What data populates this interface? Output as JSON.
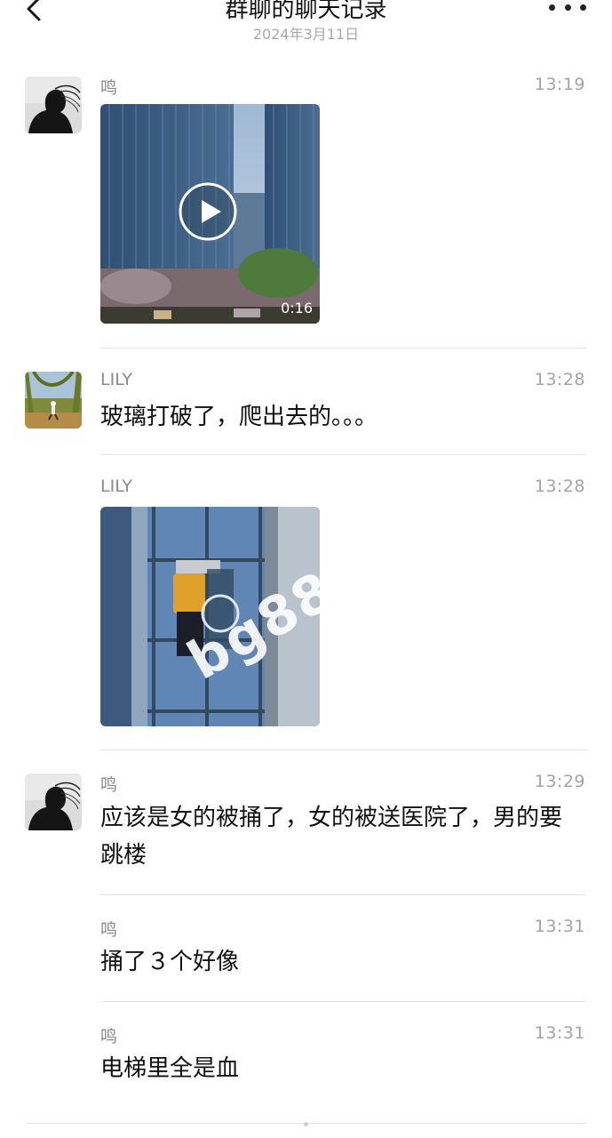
{
  "header": {
    "title": "群聊的聊天记录",
    "date": "2024年3月11日"
  },
  "icons": {
    "back": "chevron-left-icon",
    "more": "more-dots-icon",
    "play": "play-icon"
  },
  "messages": [
    {
      "sender": "鸣",
      "time": "13:19",
      "type": "video",
      "video": {
        "duration": "0:16"
      }
    },
    {
      "sender": "LILY",
      "time": "13:28",
      "type": "text",
      "text": "玻璃打破了，爬出去的。。。"
    },
    {
      "sender": "LILY",
      "time": "13:28",
      "type": "image",
      "watermark": "bg88"
    },
    {
      "sender": "鸣",
      "time": "13:29",
      "type": "text",
      "text": "应该是女的被捅了，女的被送医院了，男的要跳楼"
    },
    {
      "sender": "鸣",
      "time": "13:31",
      "type": "text",
      "text": "捅了３个好像"
    },
    {
      "sender": "鸣",
      "time": "13:31",
      "type": "text",
      "text": "电梯里全是血"
    }
  ]
}
